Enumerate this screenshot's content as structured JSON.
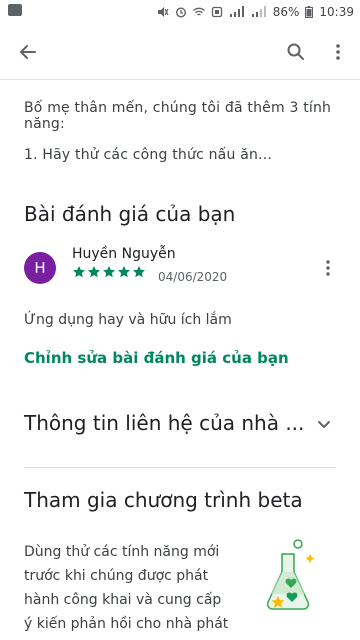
{
  "status_bar": {
    "battery": "86%",
    "time": "10:39"
  },
  "app_bar": {
    "back_icon": "arrow-back-icon",
    "search_icon": "search-icon",
    "more_icon": "more-vert-icon"
  },
  "whats_new": {
    "line1": "Bố mẹ thân mến, chúng tôi đã thêm 3 tính năng:",
    "line2": "1. Hãy thử các công thức nấu ăn..."
  },
  "your_review": {
    "title": "Bài đánh giá của bạn",
    "avatar_letter": "H",
    "avatar_color": "#7b1fa2",
    "reviewer_name": "Huyền Nguyễn",
    "rating": 5,
    "rating_max": 5,
    "star_color": "#01875f",
    "date": "04/06/2020",
    "text": "Ứng dụng hay và hữu ích lắm",
    "edit_link": "Chỉnh sửa bài đánh giá của bạn",
    "accent_color": "#01875f"
  },
  "developer_contact": {
    "title": "Thông tin liên hệ của nhà ..."
  },
  "beta": {
    "title": "Tham gia chương trình beta",
    "lines": [
      "Dùng thử các tính năng mới",
      "trước khi chúng được phát",
      "hành công khai và cung cấp",
      "ý kiến phản hồi cho nhà phát"
    ],
    "illustration": "beta-flask-icon"
  }
}
